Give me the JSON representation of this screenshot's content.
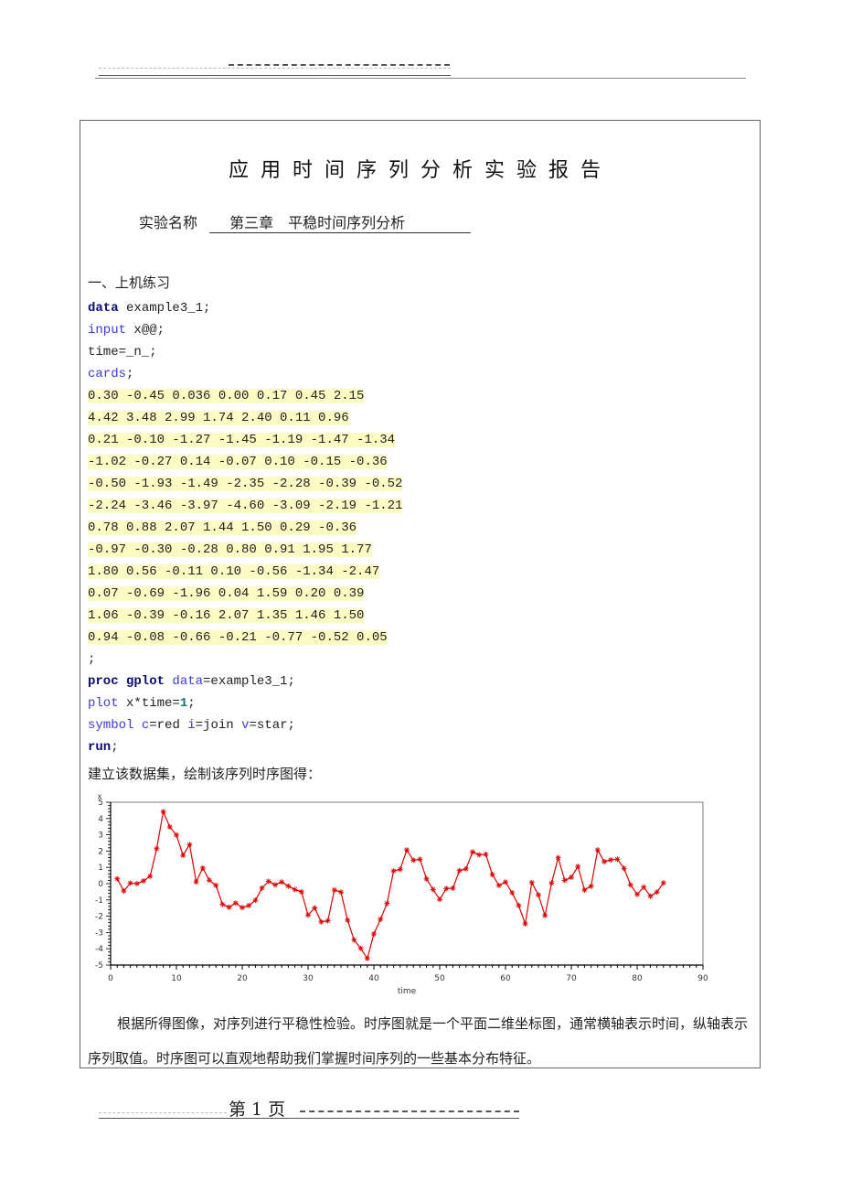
{
  "header": {
    "decoration": "dashed header rule"
  },
  "report": {
    "title": "应用时间序列分析实验报告",
    "experiment_label": "实验名称",
    "experiment_name": "第三章　平稳时间序列分析",
    "section_title": "一、上机练习"
  },
  "code": {
    "line1": {
      "kw": "data",
      "rest": " example3_1;"
    },
    "line2": {
      "kw": "input",
      "rest": " x@@;"
    },
    "line3": {
      "rest": "time=_n_;"
    },
    "line4": {
      "kw": "cards",
      "rest": ";"
    },
    "data_lines": [
      "0.30 -0.45 0.036 0.00 0.17 0.45 2.15",
      "4.42 3.48 2.99 1.74 2.40 0.11 0.96",
      "0.21 -0.10 -1.27 -1.45 -1.19 -1.47 -1.34",
      "-1.02 -0.27 0.14 -0.07 0.10 -0.15 -0.36",
      "-0.50 -1.93 -1.49 -2.35 -2.28 -0.39 -0.52",
      "-2.24 -3.46 -3.97 -4.60 -3.09 -2.19 -1.21",
      "0.78 0.88 2.07 1.44 1.50 0.29 -0.36",
      "-0.97 -0.30 -0.28 0.80 0.91 1.95 1.77",
      "1.80 0.56 -0.11 0.10 -0.56 -1.34 -2.47",
      "0.07 -0.69 -1.96 0.04 1.59 0.20 0.39",
      "1.06 -0.39 -0.16 2.07 1.35 1.46 1.50",
      "0.94 -0.08 -0.66 -0.21 -0.77 -0.52 0.05"
    ],
    "semicolon": ";",
    "proc": {
      "kw": "proc gplot",
      "opt": "data",
      "rest": "=example3_1;"
    },
    "plot": {
      "kw": "plot",
      "rest": " x*time=",
      "num": "1",
      "end": ";"
    },
    "symbol": {
      "kw": "symbol",
      "c": "c",
      "c_val": "=red ",
      "i": "i",
      "i_val": "=join ",
      "v": "v",
      "v_val": "=star;"
    },
    "run": {
      "kw": "run",
      "rest": ";"
    }
  },
  "caption": "建立该数据集，绘制该序列时序图得：",
  "chart_data": {
    "type": "line",
    "title": "",
    "xlabel": "time",
    "ylabel": "x",
    "xlim": [
      0,
      90
    ],
    "ylim": [
      -5,
      5
    ],
    "xticks": [
      "0",
      "10",
      "20",
      "30",
      "40",
      "50",
      "60",
      "70",
      "80",
      "90"
    ],
    "yticks": [
      "5",
      "4",
      "3",
      "2",
      "1",
      "0",
      "-1",
      "-2",
      "-3",
      "-4",
      "-5"
    ],
    "marker": "star",
    "color": "#e00000",
    "grid": false,
    "series": [
      {
        "name": "x",
        "x": [
          1,
          2,
          3,
          4,
          5,
          6,
          7,
          8,
          9,
          10,
          11,
          12,
          13,
          14,
          15,
          16,
          17,
          18,
          19,
          20,
          21,
          22,
          23,
          24,
          25,
          26,
          27,
          28,
          29,
          30,
          31,
          32,
          33,
          34,
          35,
          36,
          37,
          38,
          39,
          40,
          41,
          42,
          43,
          44,
          45,
          46,
          47,
          48,
          49,
          50,
          51,
          52,
          53,
          54,
          55,
          56,
          57,
          58,
          59,
          60,
          61,
          62,
          63,
          64,
          65,
          66,
          67,
          68,
          69,
          70,
          71,
          72,
          73,
          74,
          75,
          76,
          77,
          78,
          79,
          80,
          81,
          82,
          83,
          84
        ],
        "values": [
          0.3,
          -0.45,
          0.036,
          0.0,
          0.17,
          0.45,
          2.15,
          4.42,
          3.48,
          2.99,
          1.74,
          2.4,
          0.11,
          0.96,
          0.21,
          -0.1,
          -1.27,
          -1.45,
          -1.19,
          -1.47,
          -1.34,
          -1.02,
          -0.27,
          0.14,
          -0.07,
          0.1,
          -0.15,
          -0.36,
          -0.5,
          -1.93,
          -1.49,
          -2.35,
          -2.28,
          -0.39,
          -0.52,
          -2.24,
          -3.46,
          -3.97,
          -4.6,
          -3.09,
          -2.19,
          -1.21,
          0.78,
          0.88,
          2.07,
          1.44,
          1.5,
          0.29,
          -0.36,
          -0.97,
          -0.3,
          -0.28,
          0.8,
          0.91,
          1.95,
          1.77,
          1.8,
          0.56,
          -0.11,
          0.1,
          -0.56,
          -1.34,
          -2.47,
          0.07,
          -0.69,
          -1.96,
          0.04,
          1.59,
          0.2,
          0.39,
          1.06,
          -0.39,
          -0.16,
          2.07,
          1.35,
          1.46,
          1.5,
          0.94,
          -0.08,
          -0.66,
          -0.21,
          -0.77,
          -0.52,
          0.05
        ]
      }
    ]
  },
  "paragraph": "根据所得图像，对序列进行平稳性检验。时序图就是一个平面二维坐标图，通常横轴表示时间，纵轴表示序列取值。时序图可以直观地帮助我们掌握时间序列的一些基本分布特征。",
  "footer": {
    "page_label": "第 1 页"
  }
}
